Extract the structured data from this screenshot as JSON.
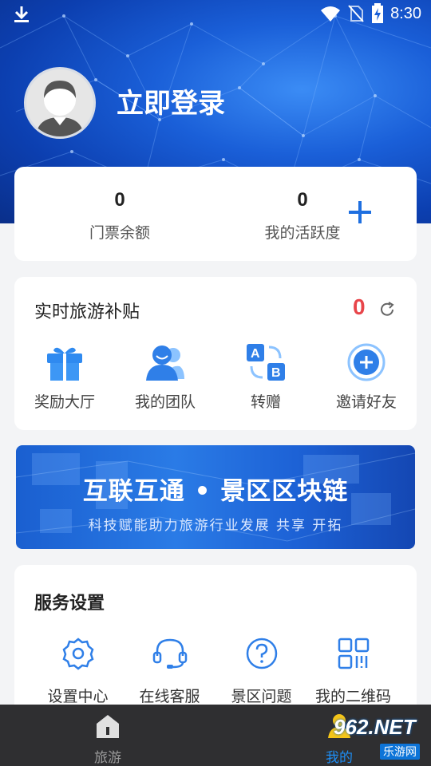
{
  "status_bar": {
    "time": "8:30"
  },
  "profile": {
    "login_text": "立即登录"
  },
  "stats": [
    {
      "value": "0",
      "label": "门票余额"
    },
    {
      "value": "0",
      "label": "我的活跃度"
    }
  ],
  "subsidy": {
    "title": "实时旅游补贴",
    "value": "0",
    "actions": [
      {
        "label": "奖励大厅",
        "icon": "gift-icon"
      },
      {
        "label": "我的团队",
        "icon": "team-icon"
      },
      {
        "label": "转赠",
        "icon": "transfer-icon"
      },
      {
        "label": "邀请好友",
        "icon": "invite-icon"
      }
    ]
  },
  "banner": {
    "headline": "互联互通 • 景区区块链",
    "tagline": "科技赋能助力旅游行业发展 共享 开拓"
  },
  "services": {
    "title": "服务设置",
    "items": [
      {
        "label": "设置中心",
        "icon": "gear-icon"
      },
      {
        "label": "在线客服",
        "icon": "headset-icon"
      },
      {
        "label": "景区问题",
        "icon": "question-icon"
      },
      {
        "label": "我的二维码",
        "icon": "qrcode-icon"
      }
    ]
  },
  "tabbar": {
    "tabs": [
      {
        "label": "旅游",
        "icon": "home-icon"
      },
      {
        "label": "我的",
        "icon": "user-icon"
      }
    ]
  },
  "watermark": {
    "brand": "962.NET",
    "sub": "乐游网"
  },
  "colors": {
    "accent": "#1e6fe0",
    "badge_red": "#e8454a",
    "tab_active": "#1e8ef5"
  }
}
